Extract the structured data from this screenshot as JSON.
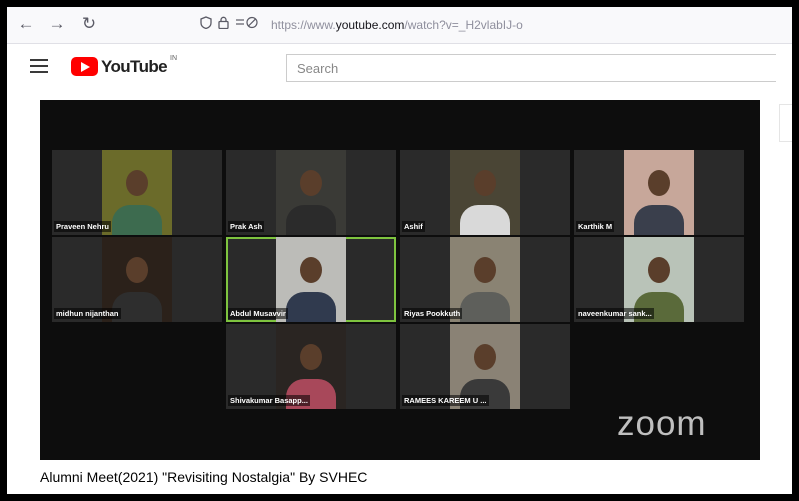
{
  "browser": {
    "back_icon": "←",
    "forward_icon": "→",
    "reload_icon": "↻",
    "url_prefix": "https://www.",
    "url_domain": "youtube.com",
    "url_suffix": "/watch?v=_H2vlabIJ-o"
  },
  "header": {
    "logo_text": "YouTube",
    "country": "IN",
    "search_placeholder": "Search"
  },
  "video": {
    "title": "Alumni Meet(2021) \"Revisiting Nostalgia\" By SVHEC",
    "watermark": "zoom",
    "participants": [
      {
        "name": "Praveen Nehru",
        "feed": "#6b6b2a",
        "shirt": "#3d6b4f"
      },
      {
        "name": "Prak Ash",
        "feed": "#3a3a36",
        "shirt": "#2b2b2b"
      },
      {
        "name": "Ashif",
        "feed": "#4a4535",
        "shirt": "#d9d9d9"
      },
      {
        "name": "Karthik M",
        "feed": "#c7a79a",
        "shirt": "#3a3f4c"
      },
      {
        "name": "midhun nijanthan",
        "feed": "#2b211a",
        "shirt": "#2e2e2e"
      },
      {
        "name": "Abdul Musavvir",
        "feed": "#bcbcb8",
        "shirt": "#303a4e"
      },
      {
        "name": "Riyas Pookkuth",
        "feed": "#8a8373",
        "shirt": "#5e5f5b"
      },
      {
        "name": "naveenkumar sank...",
        "feed": "#b9c3b8",
        "shirt": "#5a6a3a"
      },
      {
        "name": "Shivakumar Basapp...",
        "feed": "#2a2522",
        "shirt": "#a8485a"
      },
      {
        "name": "RAMEES KAREEM U ...",
        "feed": "#8a8275",
        "shirt": "#3a3a3a"
      }
    ]
  }
}
